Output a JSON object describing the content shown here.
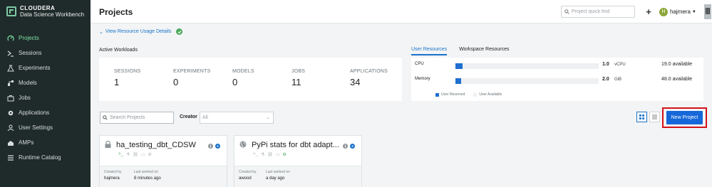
{
  "brand": {
    "line1": "CLOUDERA",
    "line2": "Data Science Workbench"
  },
  "nav": [
    {
      "label": "Projects",
      "icon": "projects-icon",
      "active": true
    },
    {
      "label": "Sessions",
      "icon": "terminal-icon",
      "active": false
    },
    {
      "label": "Experiments",
      "icon": "flask-icon",
      "active": false
    },
    {
      "label": "Models",
      "icon": "models-icon",
      "active": false
    },
    {
      "label": "Jobs",
      "icon": "briefcase-icon",
      "active": false
    },
    {
      "label": "Applications",
      "icon": "gear-icon",
      "active": false
    },
    {
      "label": "User Settings",
      "icon": "user-icon",
      "active": false
    },
    {
      "label": "AMPs",
      "icon": "amps-icon",
      "active": false
    },
    {
      "label": "Runtime Catalog",
      "icon": "list-icon",
      "active": false
    }
  ],
  "header": {
    "title": "Projects",
    "search_placeholder": "Project quick find",
    "plus": "+",
    "user_initial": "H",
    "username": "hajmera"
  },
  "resource_link": "View Resource Usage Details",
  "workloads": {
    "title": "Active Workloads",
    "stats": [
      {
        "label": "SESSIONS",
        "value": "1"
      },
      {
        "label": "EXPERIMENTS",
        "value": "0"
      },
      {
        "label": "MODELS",
        "value": "0"
      },
      {
        "label": "JOBS",
        "value": "11"
      },
      {
        "label": "APPLICATIONS",
        "value": "34"
      }
    ]
  },
  "resources": {
    "tabs": [
      "User Resources",
      "Workspace Resources"
    ],
    "rows": [
      {
        "label": "CPU",
        "value": "1.0",
        "unit": "vCPU",
        "available": "19.0  available",
        "fraction": 0.05
      },
      {
        "label": "Memory",
        "value": "2.0",
        "unit": "GiB",
        "available": "48.0  available",
        "fraction": 0.04
      }
    ],
    "legend": [
      "User Reserved",
      "User Available"
    ],
    "colors": {
      "reserved": "#1e6fd0",
      "available": "#eef0f2"
    }
  },
  "filters": {
    "search_placeholder": "Search Projects",
    "creator_label": "Creator",
    "creator_value": "All",
    "new_project": "New Project"
  },
  "projects": [
    {
      "title": "ha_testing_dbt_CDSW",
      "created_by_label": "Created by",
      "created_by": "hajmera",
      "last_label": "Last worked on",
      "last": "8 minutes ago",
      "icon": "lock-icon"
    },
    {
      "title": "PyPi stats for dbt adapt...",
      "created_by_label": "Created by",
      "created_by": "awood",
      "last_label": "Last worked on",
      "last": "a day ago",
      "icon": "globe-icon"
    }
  ]
}
